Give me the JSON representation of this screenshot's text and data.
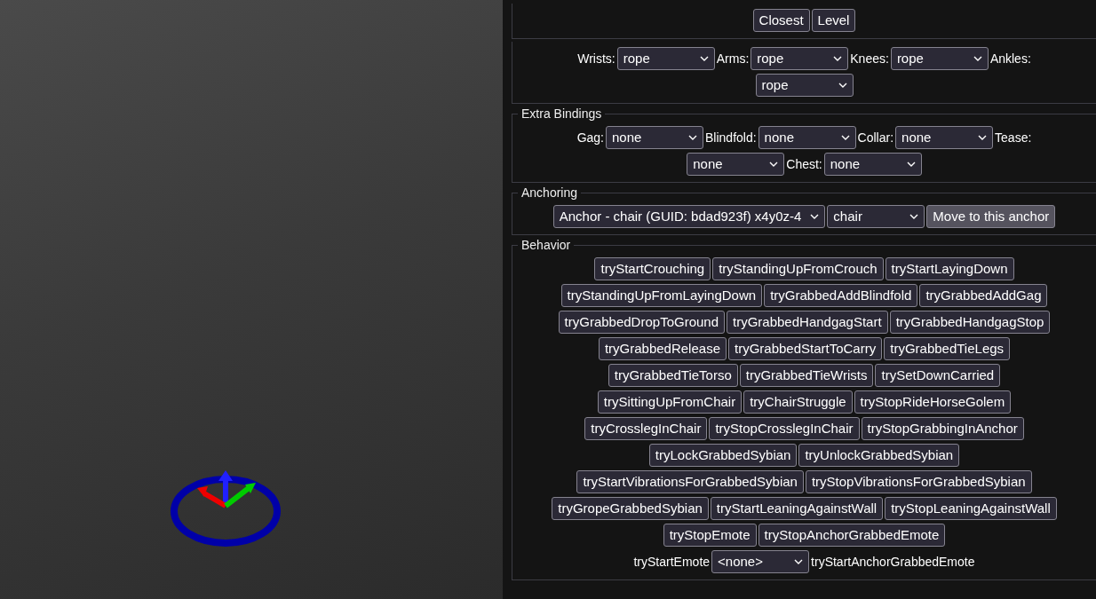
{
  "sections": [
    {
      "lines": [
        {
          "items": [
            {
              "kind": "button",
              "text": "Closest"
            },
            {
              "kind": "button",
              "text": "Level"
            }
          ]
        }
      ]
    },
    {
      "lines": [
        {
          "items": [
            {
              "kind": "label",
              "text": "Wrists:"
            },
            {
              "kind": "select",
              "value": "rope"
            },
            {
              "kind": "label",
              "text": "Arms:"
            },
            {
              "kind": "select",
              "value": "rope"
            },
            {
              "kind": "label",
              "text": "Knees:"
            },
            {
              "kind": "select",
              "value": "rope"
            },
            {
              "kind": "label",
              "text": "Ankles:"
            }
          ]
        },
        {
          "items": [
            {
              "kind": "select",
              "value": "rope"
            }
          ]
        }
      ]
    },
    {
      "legend": "Extra Bindings",
      "lines": [
        {
          "items": [
            {
              "kind": "label",
              "text": "Gag:"
            },
            {
              "kind": "select",
              "value": "none"
            },
            {
              "kind": "label",
              "text": "Blindfold:"
            },
            {
              "kind": "select",
              "value": "none"
            },
            {
              "kind": "label",
              "text": "Collar:"
            },
            {
              "kind": "select",
              "value": "none"
            },
            {
              "kind": "label",
              "text": "Tease:"
            }
          ]
        },
        {
          "items": [
            {
              "kind": "select",
              "value": "none"
            },
            {
              "kind": "label",
              "text": "Chest:"
            },
            {
              "kind": "select",
              "value": "none"
            }
          ]
        }
      ]
    },
    {
      "legend": "Anchoring",
      "lines": [
        {
          "items": [
            {
              "kind": "select",
              "value": "Anchor - chair (GUID: bdad923f) x4y0z-4"
            },
            {
              "kind": "select",
              "value": "chair"
            },
            {
              "kind": "button",
              "text": "Move to this anchor",
              "strong": true
            }
          ]
        }
      ]
    },
    {
      "legend": "Behavior",
      "lines": [
        {
          "items": [
            {
              "kind": "button",
              "text": "tryStartCrouching"
            },
            {
              "kind": "button",
              "text": "tryStandingUpFromCrouch"
            },
            {
              "kind": "button",
              "text": "tryStartLayingDown"
            }
          ]
        },
        {
          "items": [
            {
              "kind": "button",
              "text": "tryStandingUpFromLayingDown"
            },
            {
              "kind": "button",
              "text": "tryGrabbedAddBlindfold"
            },
            {
              "kind": "button",
              "text": "tryGrabbedAddGag"
            }
          ]
        },
        {
          "items": [
            {
              "kind": "button",
              "text": "tryGrabbedDropToGround"
            },
            {
              "kind": "button",
              "text": "tryGrabbedHandgagStart"
            },
            {
              "kind": "button",
              "text": "tryGrabbedHandgagStop"
            }
          ]
        },
        {
          "items": [
            {
              "kind": "button",
              "text": "tryGrabbedRelease"
            },
            {
              "kind": "button",
              "text": "tryGrabbedStartToCarry"
            },
            {
              "kind": "button",
              "text": "tryGrabbedTieLegs"
            }
          ]
        },
        {
          "items": [
            {
              "kind": "button",
              "text": "tryGrabbedTieTorso"
            },
            {
              "kind": "button",
              "text": "tryGrabbedTieWrists"
            },
            {
              "kind": "button",
              "text": "trySetDownCarried"
            }
          ]
        },
        {
          "items": [
            {
              "kind": "button",
              "text": "trySittingUpFromChair"
            },
            {
              "kind": "button",
              "text": "tryChairStruggle"
            },
            {
              "kind": "button",
              "text": "tryStopRideHorseGolem"
            }
          ]
        },
        {
          "items": [
            {
              "kind": "button",
              "text": "tryCrosslegInChair"
            },
            {
              "kind": "button",
              "text": "tryStopCrosslegInChair"
            },
            {
              "kind": "button",
              "text": "tryStopGrabbingInAnchor"
            }
          ]
        },
        {
          "items": [
            {
              "kind": "button",
              "text": "tryLockGrabbedSybian"
            },
            {
              "kind": "button",
              "text": "tryUnlockGrabbedSybian"
            }
          ]
        },
        {
          "items": [
            {
              "kind": "button",
              "text": "tryStartVibrationsForGrabbedSybian"
            },
            {
              "kind": "button",
              "text": "tryStopVibrationsForGrabbedSybian"
            }
          ]
        },
        {
          "items": [
            {
              "kind": "button",
              "text": "tryGropeGrabbedSybian"
            },
            {
              "kind": "button",
              "text": "tryStartLeaningAgainstWall"
            },
            {
              "kind": "button",
              "text": "tryStopLeaningAgainstWall"
            }
          ]
        },
        {
          "items": [
            {
              "kind": "button",
              "text": "tryStopEmote"
            },
            {
              "kind": "button",
              "text": "tryStopAnchorGrabbedEmote"
            }
          ]
        },
        {
          "items": [
            {
              "kind": "label",
              "text": "tryStartEmote"
            },
            {
              "kind": "select",
              "value": "<none>"
            },
            {
              "kind": "label",
              "text": "tryStartAnchorGrabbedEmote"
            }
          ]
        }
      ]
    }
  ]
}
